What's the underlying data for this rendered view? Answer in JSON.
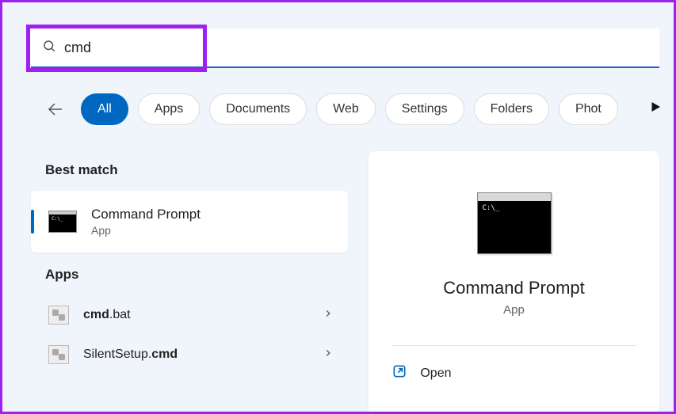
{
  "search": {
    "query": "cmd"
  },
  "filters": {
    "items": [
      {
        "label": "All",
        "active": true
      },
      {
        "label": "Apps",
        "active": false
      },
      {
        "label": "Documents",
        "active": false
      },
      {
        "label": "Web",
        "active": false
      },
      {
        "label": "Settings",
        "active": false
      },
      {
        "label": "Folders",
        "active": false
      },
      {
        "label": "Phot",
        "active": false
      }
    ]
  },
  "results": {
    "best_match_header": "Best match",
    "best_match": {
      "title": "Command Prompt",
      "subtitle": "App"
    },
    "apps_header": "Apps",
    "apps": [
      {
        "prefix_bold": "cmd",
        "suffix": ".bat"
      },
      {
        "prefix": "SilentSetup.",
        "suffix_bold": "cmd"
      }
    ]
  },
  "preview": {
    "title": "Command Prompt",
    "subtitle": "App",
    "actions": {
      "open": "Open"
    }
  }
}
